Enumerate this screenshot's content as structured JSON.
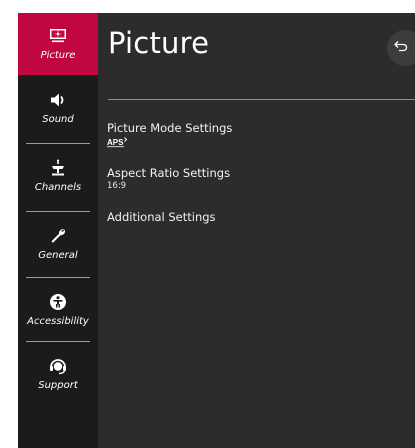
{
  "page": {
    "title": "Picture",
    "back_icon": "back-arrow-icon"
  },
  "sidebar": {
    "items": [
      {
        "label": "Picture",
        "icon": "picture-icon",
        "active": true
      },
      {
        "label": "Sound",
        "icon": "speaker-icon",
        "active": false
      },
      {
        "label": "Channels",
        "icon": "antenna-icon",
        "active": false
      },
      {
        "label": "General",
        "icon": "wrench-icon",
        "active": false
      },
      {
        "label": "Accessibility",
        "icon": "accessibility-icon",
        "active": false
      },
      {
        "label": "Support",
        "icon": "support-icon",
        "active": false
      }
    ]
  },
  "menu": {
    "items": [
      {
        "label": "Picture Mode Settings",
        "value_logo": "APS",
        "value_logo_icon": "aps-logo-icon"
      },
      {
        "label": "Aspect Ratio Settings",
        "value": "16:9"
      },
      {
        "label": "Additional Settings"
      }
    ]
  },
  "colors": {
    "accent": "#c0073f",
    "sidebar_bg": "#1b1b1b",
    "main_bg": "#2c2c2c",
    "text": "#ffffff"
  }
}
